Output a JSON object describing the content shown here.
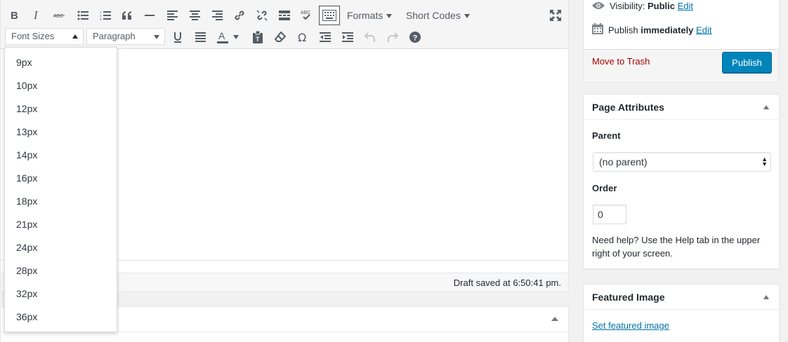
{
  "toolbar": {
    "formats_label": "Formats",
    "shortcodes_label": "Short Codes",
    "font_sizes_label": "Font Sizes",
    "paragraph_label": "Paragraph",
    "spellcheck_text": "ABC",
    "strike_text": "ABC"
  },
  "font_sizes": {
    "options": [
      "9px",
      "10px",
      "12px",
      "13px",
      "14px",
      "16px",
      "18px",
      "21px",
      "24px",
      "28px",
      "32px",
      "36px"
    ]
  },
  "status": {
    "draft_saved": "Draft saved at 6:50:41 pm."
  },
  "publish": {
    "visibility_label": "Visibility:",
    "visibility_value": "Public",
    "publish_label": "Publish",
    "publish_value": "immediately",
    "edit_label": "Edit",
    "trash_label": "Move to Trash",
    "publish_button": "Publish"
  },
  "page_attributes": {
    "title": "Page Attributes",
    "parent_label": "Parent",
    "parent_value": "(no parent)",
    "order_label": "Order",
    "order_value": "0",
    "help_text": "Need help? Use the Help tab in the upper right of your screen."
  },
  "featured_image": {
    "title": "Featured Image",
    "link": "Set featured image"
  },
  "colors": {
    "accent": "#0085ba",
    "link": "#0073aa",
    "danger": "#aa0000"
  }
}
